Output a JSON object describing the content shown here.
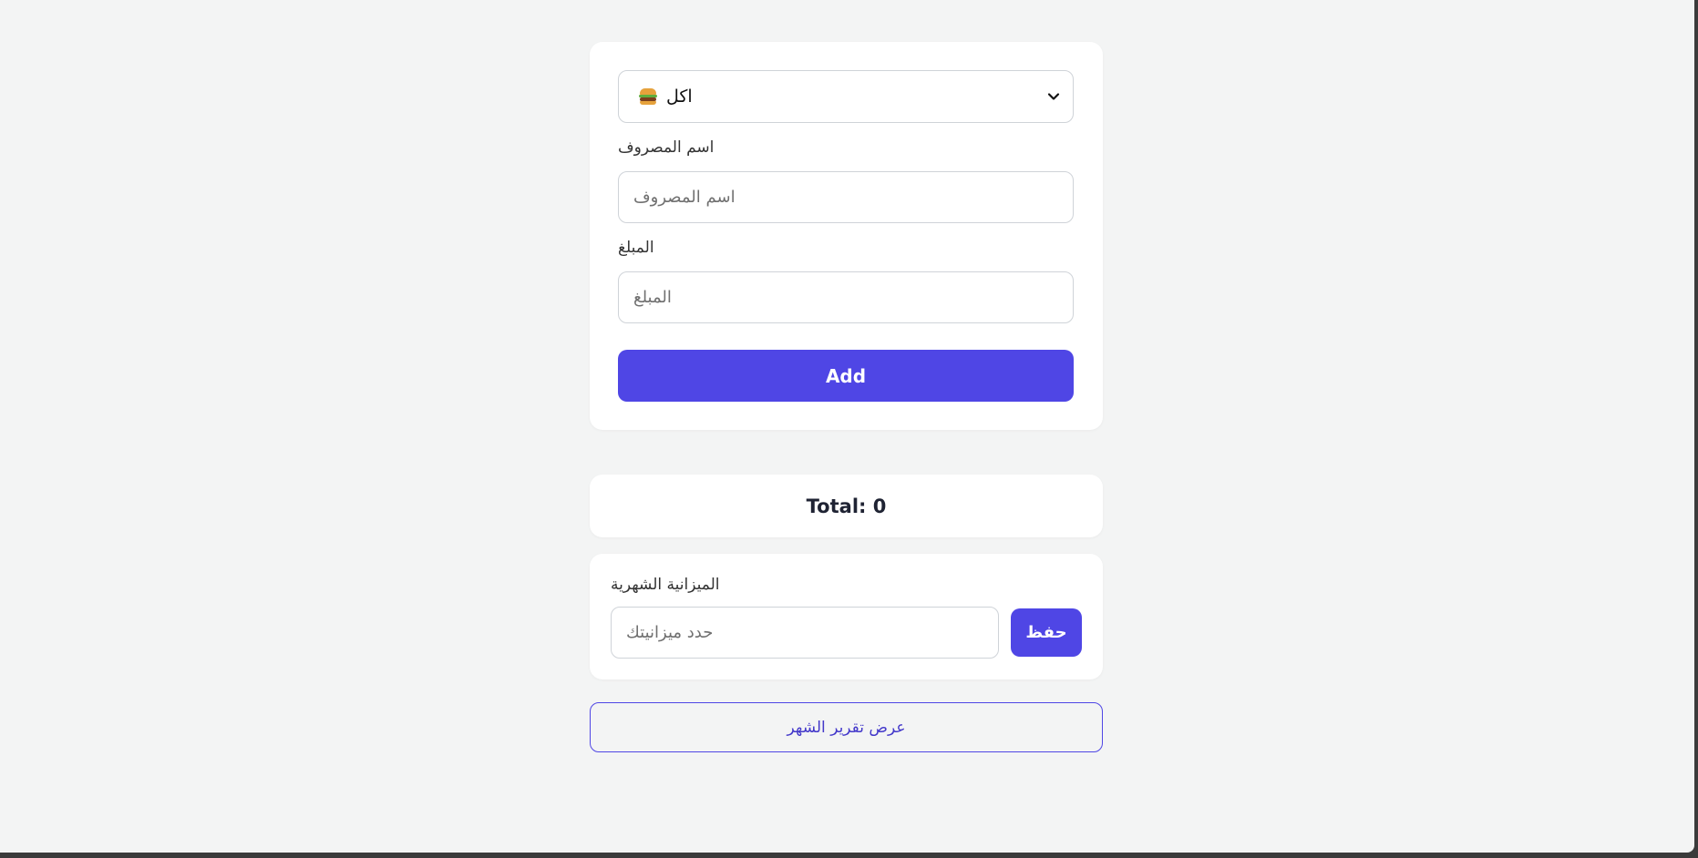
{
  "form": {
    "category_select": {
      "selected_label": "اكل",
      "selected_icon": "burger-icon"
    },
    "expense_name": {
      "label": "اسم المصروف",
      "placeholder": "اسم المصروف",
      "value": ""
    },
    "amount": {
      "label": "المبلغ",
      "placeholder": "المبلغ",
      "value": ""
    },
    "add_label": "Add"
  },
  "total": {
    "text": "Total: 0"
  },
  "budget": {
    "label": "الميزانية الشهرية",
    "placeholder": "حدد ميزانيتك",
    "value": "",
    "save_label": "حفظ"
  },
  "report": {
    "label": "عرض تقرير الشهر"
  },
  "colors": {
    "accent": "#4f46e5",
    "page_background": "#f3f4f4",
    "card_background": "#ffffff",
    "text_dark": "#1f2333"
  }
}
